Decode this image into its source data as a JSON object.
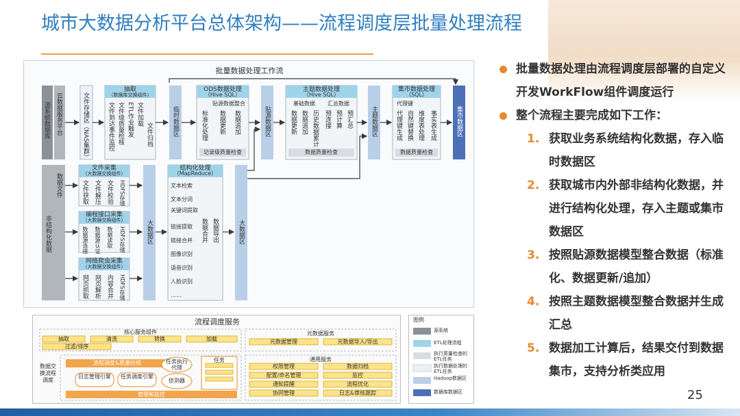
{
  "title": "城市大数据分析平台总体架构——流程调度层批量处理流程",
  "page_number": "25",
  "bullets": [
    {
      "text": "批量数据处理由流程调度层部署的自定义开发WorkFlow组件调度运行"
    },
    {
      "text": "整个流程主要完成如下工作："
    }
  ],
  "steps": [
    {
      "num": "1.",
      "text": "获取业务系统结构化数据，存入临时数据区"
    },
    {
      "num": "2.",
      "text": "获取城市内外部非结构化数据，并进行结构化处理，存入主题或集市数据区"
    },
    {
      "num": "3.",
      "text": "按照贴源数据模型整合数据（标准化、数据更新/追加）"
    },
    {
      "num": "4.",
      "text": "按照主题数据模型整合数据并生成汇总"
    },
    {
      "num": "5.",
      "text": "数据加工计算后，结果交付到数据集市，支持分析类应用"
    }
  ],
  "diagram": {
    "title": "批量数据处理工作流",
    "source_db": "源系统数据库",
    "cloud_platform": "云数据服务平台",
    "file_store": "文件存储区（NAS集群）",
    "extract": {
      "title": "抽取",
      "subtitle": "（数据库交换组件）",
      "cols": [
        "文件到达事件监控",
        "文件级质量检核",
        "ETL作业触发",
        "文件加载",
        "文件归档"
      ]
    },
    "temp_area": "临时数据区",
    "ods": {
      "title": "ODS数据处理",
      "subtitle": "（Hive SQL）",
      "group": "贴源数据整合",
      "cols": [
        "标准化处理",
        "数据更新",
        "数据追加"
      ],
      "footer": "记录级质量检查"
    },
    "source_area": "贴源数据区",
    "theme": {
      "title": "主题数据处理",
      "subtitle": "（Hive SQL）",
      "group1": "基础数据",
      "group2": "汇总数据",
      "cols": [
        "数据更新",
        "数据追加",
        "历史数据累计",
        "预连接",
        "预计算",
        "预汇总"
      ],
      "footer": "数据质量检查"
    },
    "theme_area": "主题数据区",
    "mart": {
      "title": "集市数据处理",
      "subtitle": "（SQL）",
      "group": "代理键",
      "cols": [
        "代理键生成",
        "自然键替换",
        "维度表处理",
        "事实表生成"
      ],
      "footer": "数据质量检查"
    },
    "mart_area": "集市数据区",
    "unstructured": "非结构化数据",
    "data_file": "数据文件",
    "file_collect": {
      "title": "文件采集",
      "subtitle": "（大数据交换组件）",
      "cols": [
        "文件获取",
        "文件解压",
        "文件校验",
        "HDFS存储"
      ]
    },
    "api_collect": {
      "title": "编程接口采集",
      "subtitle": "（大数据交换组件）",
      "cols": [
        "数据源连接",
        "数据源认证",
        "数据读取",
        "HDFS存储"
      ]
    },
    "crawler": {
      "title": "网络爬虫采集",
      "subtitle": "（大数据交换组件）",
      "cols": [
        "网页抓取",
        "网页解析",
        "内容合并",
        "HDFS存储"
      ]
    },
    "big_area": "大数据区",
    "structuring": {
      "title": "结构化处理",
      "subtitle": "（MapReduce）",
      "items": [
        "文本检索",
        "文本分词",
        "关键词提取",
        "链接提取",
        "链接合并",
        "图像识别",
        "语音识别",
        "人脸识别",
        "……"
      ],
      "col2": "数据合并",
      "col3": "数据导出"
    },
    "big_area2": "大数据区"
  },
  "services": {
    "title": "流程调度服务",
    "core": "核心服务组件",
    "core_items": [
      "抽取",
      "清洗",
      "转换",
      "加载",
      "过滤/排序"
    ],
    "meta": "元数据服务",
    "meta_items": [
      "元数据管理",
      "元数据导入/导出"
    ],
    "exchange": "数据交换流程调度",
    "dispatch": "流程调度&质量检核",
    "log_engine": "日志管理引擎",
    "task_engine": "任务调度引擎",
    "agent": "任务执行代理",
    "detector": "侦测器",
    "task": "任务",
    "manage": "管理和监控",
    "common": "通用服务",
    "common_items": [
      "权限管理",
      "数据归档",
      "配置/命名管理",
      "监控",
      "通知提醒",
      "流程优化",
      "协同管理",
      "日志&审核跟踪"
    ]
  },
  "legend": {
    "title": "图例",
    "items": [
      "源系统",
      "ETL处理流程",
      "执行质量检查的ETL任务",
      "执行数据处理的ETL任务",
      "Hadoop数据区",
      "数据库数据区"
    ]
  },
  "colors": {
    "title": "#2f7ebf",
    "accent": "#e8892e",
    "header": "#9fd3ea",
    "zone": "#b9cfe8",
    "source": "#8a9199",
    "mart": "#4d6fb8"
  }
}
